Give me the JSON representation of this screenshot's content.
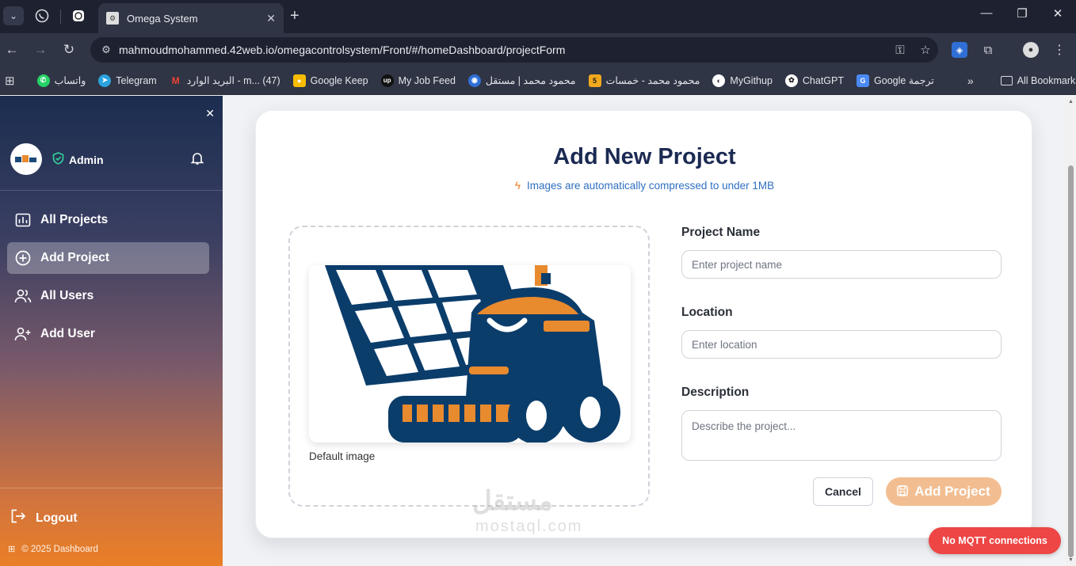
{
  "browser": {
    "active_tab_title": "Omega System",
    "url": "mahmoudmohammed.42web.io/omegacontrolsystem/Front/#/homeDashboard/projectForm",
    "bookmarks": [
      {
        "label": "واتساب",
        "icon": "whatsapp-icon",
        "color": "#25d366"
      },
      {
        "label": "Telegram",
        "icon": "telegram-icon",
        "color": "#2aa3de"
      },
      {
        "label": "البريد الوارد - m... (47)",
        "icon": "gmail-icon",
        "color": "#ea4335"
      },
      {
        "label": "Google Keep",
        "icon": "keep-icon",
        "color": "#f9bc05"
      },
      {
        "label": "My Job Feed",
        "icon": "upwork-icon",
        "color": "#111111"
      },
      {
        "label": "محمود محمد | مستقل",
        "icon": "mostaql-icon",
        "color": "#2f6fd6"
      },
      {
        "label": "محمود محمد - خمسات",
        "icon": "khamsat-icon",
        "color": "#f2a81d"
      },
      {
        "label": "MyGithup",
        "icon": "github-icon",
        "color": "#ffffff"
      },
      {
        "label": "ChatGPT",
        "icon": "chatgpt-icon",
        "color": "#ffffff"
      },
      {
        "label": "Google ترجمة",
        "icon": "translate-icon",
        "color": "#4a8af4"
      }
    ],
    "all_bookmarks": "All Bookmarks"
  },
  "sidebar": {
    "role": "Admin",
    "nav": [
      {
        "label": "All Projects",
        "icon": "projects-icon",
        "active": false
      },
      {
        "label": "Add Project",
        "icon": "add-circle-icon",
        "active": true
      },
      {
        "label": "All Users",
        "icon": "users-icon",
        "active": false
      },
      {
        "label": "Add User",
        "icon": "add-user-icon",
        "active": false
      }
    ],
    "logout": "Logout",
    "footer": "© 2025 Dashboard"
  },
  "form": {
    "title": "Add New Project",
    "subtitle": "Images are automatically compressed to under 1MB",
    "image_caption": "Default image",
    "name_label": "Project Name",
    "name_placeholder": "Enter project name",
    "location_label": "Location",
    "location_placeholder": "Enter location",
    "description_label": "Description",
    "description_placeholder": "Describe the project...",
    "cancel": "Cancel",
    "submit": "Add Project"
  },
  "watermark": {
    "line1": "مستقل",
    "line2": "mostaql.com"
  },
  "toast": "No MQTT connections",
  "colors": {
    "accent": "#ea7f26",
    "navy": "#1b2a52",
    "danger": "#ee4545"
  }
}
